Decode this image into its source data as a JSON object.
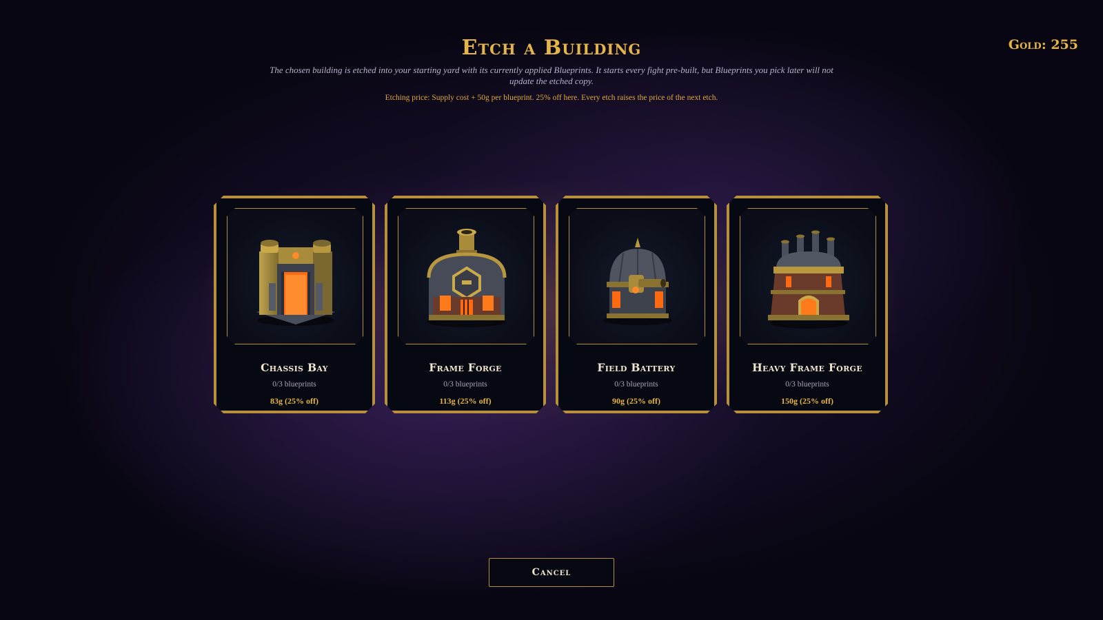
{
  "header": {
    "title": "Etch a Building",
    "gold_label": "Gold: 255",
    "description": "The chosen building is etched into your starting yard with its currently applied Blueprints. It starts every fight pre-built, but Blueprints you pick later will not update the etched copy.",
    "price_note": "Etching price: Supply cost + 50g per blueprint. 25% off here. Every etch raises the price of the next etch."
  },
  "buildings": [
    {
      "name": "Chassis Bay",
      "blueprints": "0/3 blueprints",
      "cost": "83g (25% off)",
      "icon": "chassis-bay-icon"
    },
    {
      "name": "Frame Forge",
      "blueprints": "0/3 blueprints",
      "cost": "113g (25% off)",
      "icon": "frame-forge-icon"
    },
    {
      "name": "Field Battery",
      "blueprints": "0/3 blueprints",
      "cost": "90g (25% off)",
      "icon": "field-battery-icon"
    },
    {
      "name": "Heavy Frame Forge",
      "blueprints": "0/3 blueprints",
      "cost": "150g (25% off)",
      "icon": "heavy-frame-forge-icon"
    }
  ],
  "actions": {
    "cancel_label": "Cancel"
  },
  "colors": {
    "accent_gold": "#e6b54a",
    "border_gold": "#b88f3c",
    "panel_bg": "#070912",
    "glow_orange": "#ff7a1a"
  }
}
